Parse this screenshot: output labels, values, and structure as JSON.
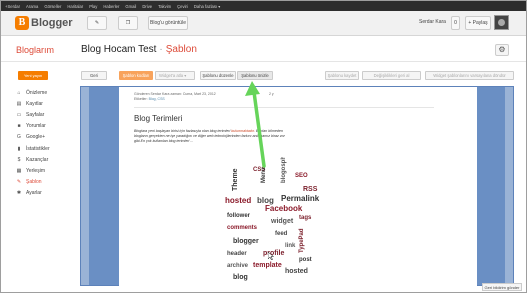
{
  "google_bar": {
    "items": [
      "+Serdar",
      "Arama",
      "Görseller",
      "Haritalar",
      "Play",
      "Haberler",
      "Gmail",
      "Drive",
      "Takvim",
      "Çeviri",
      "Daha fazlası ▾"
    ]
  },
  "header": {
    "logo_text": "Blogger",
    "view_blog_label": "Blog'u görüntüle",
    "user_name": "Serdar Kara",
    "notification_count": "0",
    "share_label": "+ Paylaş"
  },
  "title_row": {
    "section": "Bloglarım",
    "blog_name": "Blog Hocam Test",
    "separator": "·",
    "page": "Şablon"
  },
  "sidebar": {
    "new_post_label": "Yeni yayın",
    "items": [
      {
        "icon": "⌂",
        "label": "Önizleme",
        "active": false
      },
      {
        "icon": "▤",
        "label": "Kayıtlar",
        "active": false
      },
      {
        "icon": "▭",
        "label": "Sayfalar",
        "active": false
      },
      {
        "icon": "■",
        "label": "Yorumlar",
        "active": false
      },
      {
        "icon": "G",
        "label": "Google+",
        "active": false
      },
      {
        "icon": "▮",
        "label": "İstatistikler",
        "active": false
      },
      {
        "icon": "$",
        "label": "Kazançlar",
        "active": false
      },
      {
        "icon": "▦",
        "label": "Yerleşim",
        "active": false
      },
      {
        "icon": "✎",
        "label": "Şablon",
        "active": true
      },
      {
        "icon": "✱",
        "label": "Ayarlar",
        "active": false
      }
    ]
  },
  "toolbar": {
    "back_label": "Geri",
    "template_editor_label": "Şablon kodları",
    "widget_select_label": "Widget'a atla ▾",
    "format_label": "Şablonu düzenle",
    "preview_label": "Şablonu önizle",
    "save_label": "Şablonu kaydet",
    "revert_label": "Değişiklikleri geri al",
    "revert_widgets_label": "Widget şablonlarını varsayılana döndür"
  },
  "preview": {
    "meta_line1": "Gönderen Serdar Kara zaman: Cuma, Mart 23, 2012",
    "meta_time": "2 y",
    "meta_labels_prefix": "Etiketler:",
    "meta_labels": "Blog, CSS",
    "post_title": "Blog Terimleri",
    "body_line1a": "Bloglara yeni başlayan birisi için fazlasıyla olan blog terimleri",
    "body_line1b": "bulunmaktadır.",
    "body_line1c": " Bunları bilmeden",
    "body_line2": "blogların gerçekten ne işe yaradığını ve diğer web teknolojilerinden farkını anlamamız biraz zor",
    "body_line3": "gibi.En çok kullanılan blog terimleri ..."
  },
  "tag_cloud": {
    "words": [
      "CSS",
      "Theme",
      "hosted",
      "blog",
      "Facebook",
      "Permalink",
      "widget",
      "tags",
      "follower",
      "blogosphere",
      "comments",
      "Menu",
      "RSS",
      "feed",
      "blogger",
      "SEO",
      "link",
      "header",
      "profile",
      "post",
      "archive",
      "template",
      "hosted",
      "blog",
      "TypePad"
    ]
  },
  "footer": {
    "feedback_label": "Geri bildirim gönder"
  },
  "colors": {
    "accent": "#dd4b39",
    "orange": "#f57d00",
    "arrow": "#66d45a",
    "preview_bg": "#6a8fc4"
  }
}
